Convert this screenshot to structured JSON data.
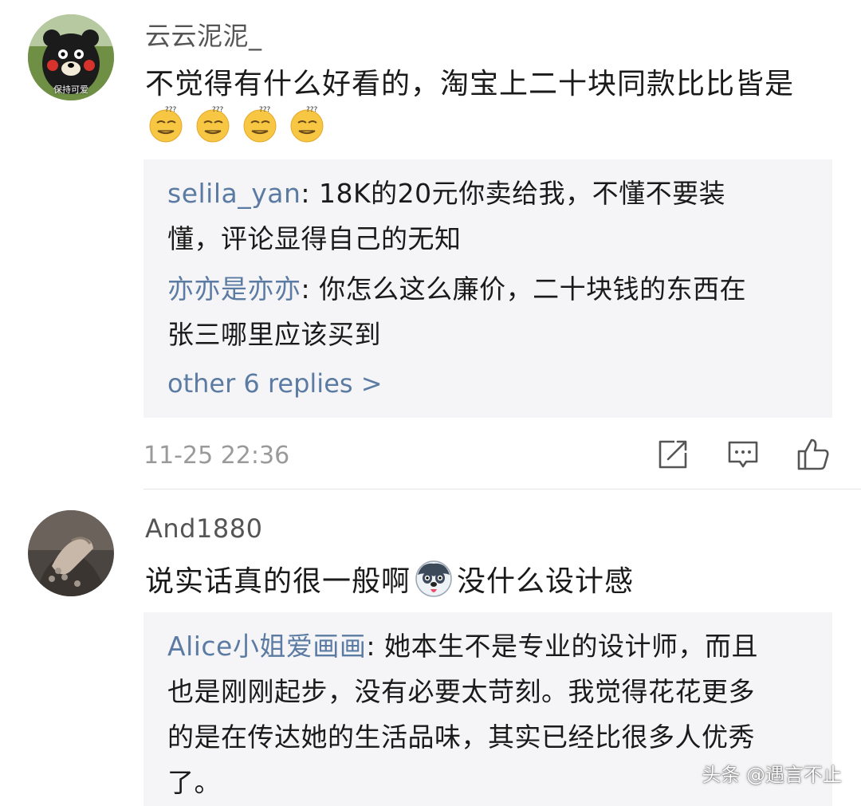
{
  "comments": [
    {
      "username": "云云泥泥_",
      "avatar_caption": "保持可爱",
      "text": "不觉得有什么好看的，淘宝上二十块同款比比皆是",
      "emojis": [
        "smirk-emoji",
        "smirk-emoji",
        "smirk-emoji",
        "smirk-emoji"
      ],
      "replies": [
        {
          "author": "selila_yan",
          "sep": ": ",
          "line1": "18K的20元你卖给我，不懂不要装",
          "line2": "懂，评论显得自己的无知"
        },
        {
          "author": "亦亦是亦亦",
          "sep": ": ",
          "line1": "你怎么这么廉价，二十块钱的东西在",
          "line2": "张三哪里应该买到"
        }
      ],
      "more_replies": "other 6 replies >",
      "timestamp": "11-25 22:36"
    },
    {
      "username": "And1880",
      "text_before": "说实话真的很一般啊",
      "text_after": " 没什么设计感",
      "emoji": "husky-emoji",
      "replies": [
        {
          "author": "Alice小姐爱画画",
          "sep": ": ",
          "line1": "她本生不是专业的设计师，而且",
          "line2": "也是刚刚起步，没有必要太苛刻。我觉得花花更多",
          "line3": "的是在传达她的生活品味，其实已经比很多人优秀",
          "line4": "了。"
        }
      ]
    }
  ],
  "actions": {
    "share_icon": "share-icon",
    "comment_icon": "comment-icon",
    "like_icon": "thumbs-up-icon"
  },
  "watermark": "头条 @遇言不止",
  "colors": {
    "link": "#5b7ba3",
    "reply_bg": "#f5f5f7",
    "timestamp": "#9a9a9a"
  }
}
